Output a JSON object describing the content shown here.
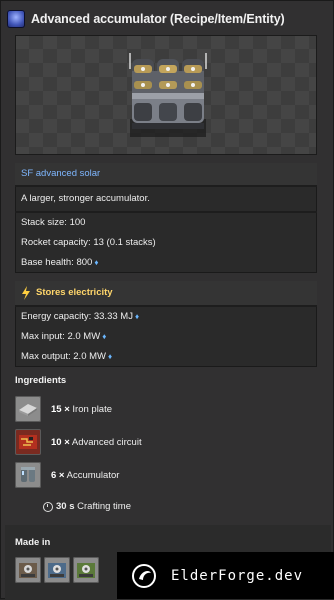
{
  "window": {
    "title": "Advanced accumulator (Recipe/Item/Entity)",
    "title_icon": "accumulator-recipe-icon"
  },
  "preview": {
    "entity_icon": "advanced-accumulator-entity-image"
  },
  "info": {
    "mod_name": "SF advanced solar",
    "description": "A larger, stronger accumulator.",
    "stack_size": "Stack size: 100",
    "rocket_capacity": "Rocket capacity: 13 (0.1 stacks)",
    "base_health": "Base health: 800"
  },
  "electricity": {
    "header": "Stores electricity",
    "energy_capacity": "Energy capacity: 33.33 MJ",
    "max_input": "Max input: 2.0 MW",
    "max_output": "Max output: 2.0 MW"
  },
  "ingredients": {
    "title": "Ingredients",
    "items": [
      {
        "qty": "15 ×",
        "name": "Iron plate",
        "icon": "iron-plate-icon"
      },
      {
        "qty": "10 ×",
        "name": "Advanced circuit",
        "icon": "advanced-circuit-icon"
      },
      {
        "qty": "6 ×",
        "name": "Accumulator",
        "icon": "accumulator-icon"
      }
    ],
    "craft_time": "30 s",
    "craft_label": "Crafting time"
  },
  "made_in": {
    "title": "Made in",
    "machines": [
      "assembling-machine-1-icon",
      "assembling-machine-2-icon",
      "assembling-machine-3-icon"
    ]
  },
  "watermark": {
    "text": "ElderForge.dev"
  },
  "colors": {
    "accent_blue": "#6bb7ff",
    "electric_yellow": "#ffd66b",
    "mod_blue": "#7fb7ff"
  }
}
